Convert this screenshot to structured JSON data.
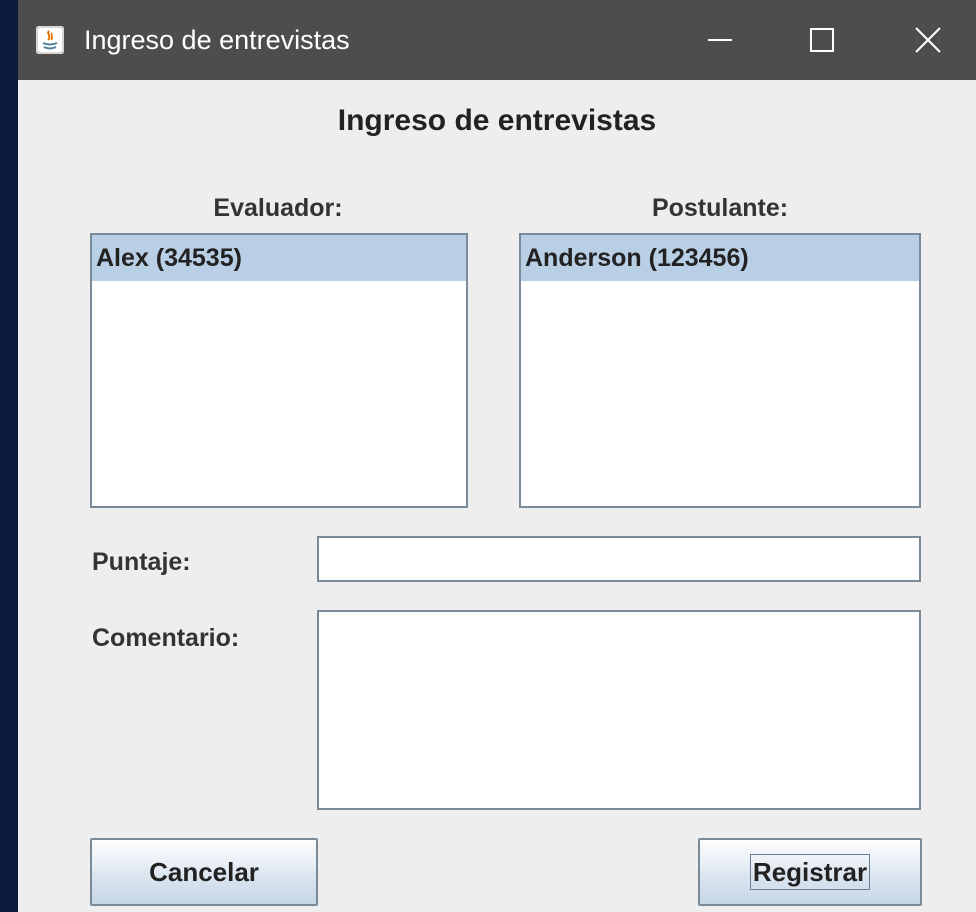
{
  "window": {
    "title": "Ingreso de entrevistas"
  },
  "form": {
    "heading": "Ingreso de entrevistas",
    "evaluator_label": "Evaluador:",
    "applicant_label": "Postulante:",
    "evaluators": [
      "Alex (34535)"
    ],
    "applicants": [
      "Anderson (123456)"
    ],
    "score_label": "Puntaje:",
    "score_value": "",
    "comment_label": "Comentario:",
    "comment_value": ""
  },
  "buttons": {
    "cancel": "Cancelar",
    "register": "Registrar"
  },
  "colors": {
    "titlebar": "#4d4d4d",
    "window_bg": "#eeeeee",
    "selection": "#b8cfe5"
  }
}
